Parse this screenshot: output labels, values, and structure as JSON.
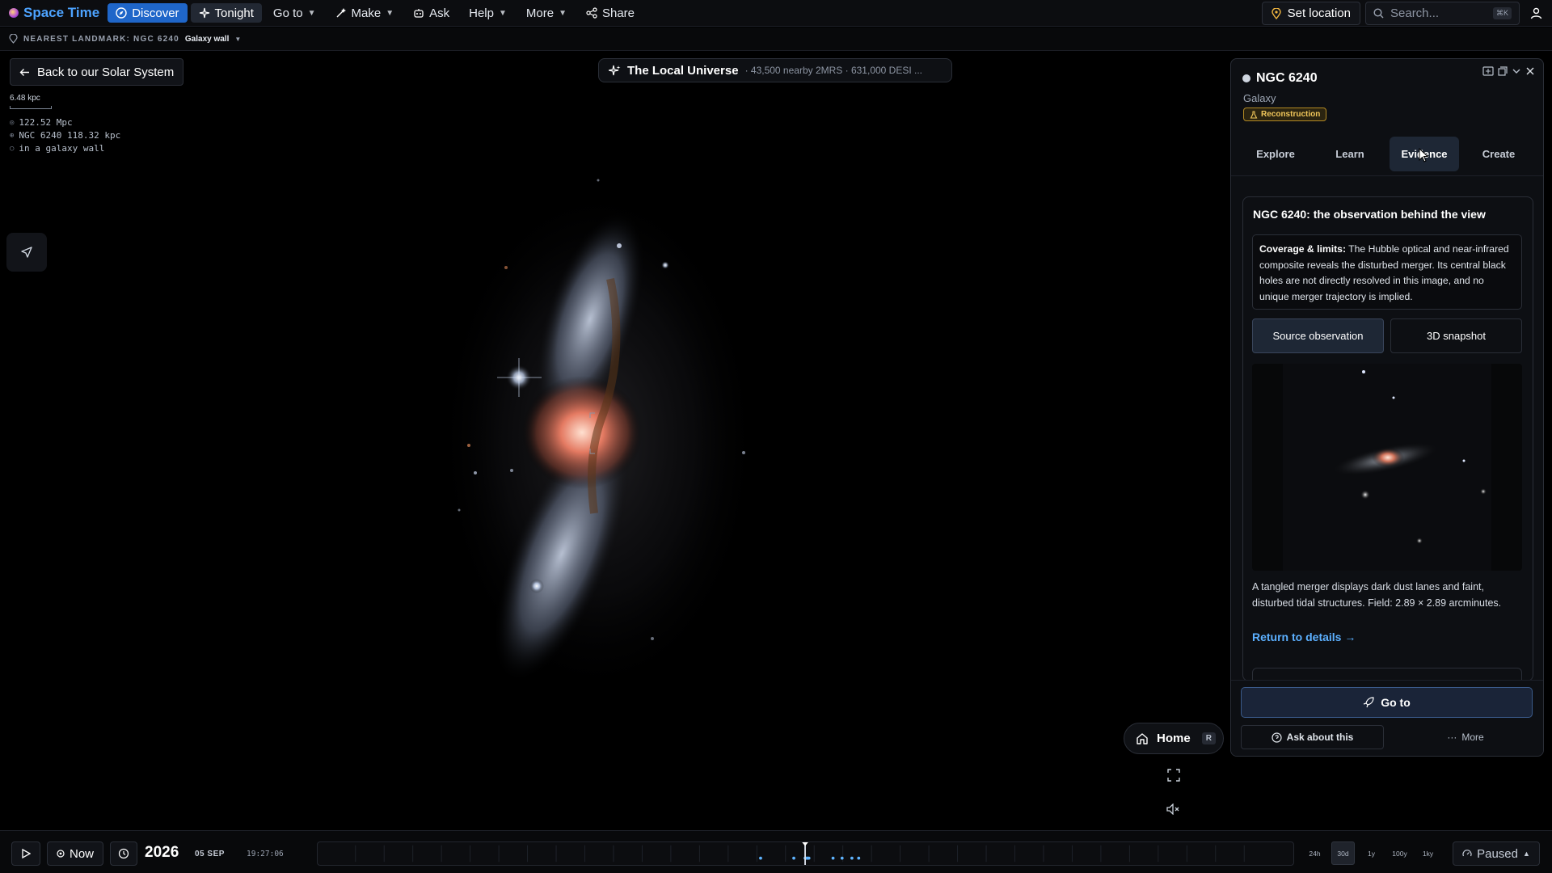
{
  "app": {
    "title": "Space Time"
  },
  "nav": {
    "discover": "Discover",
    "tonight": "Tonight",
    "goto": "Go to",
    "make": "Make",
    "ask": "Ask",
    "help": "Help",
    "more": "More",
    "share": "Share"
  },
  "top_right": {
    "set_location": "Set location",
    "search_placeholder": "Search...",
    "search_shortcut": "⌘K"
  },
  "subbar": {
    "prefix": "NEAREST LANDMARK: NGC 6240",
    "value": "Galaxy wall"
  },
  "back_button": "Back to our Solar System",
  "scale": "6.48 kpc",
  "readouts": [
    {
      "symbol": "◎",
      "text": "122.52 Mpc"
    },
    {
      "symbol": "⊕",
      "text": "NGC 6240 118.32 kpc"
    },
    {
      "symbol": "○",
      "text": "in a galaxy wall"
    }
  ],
  "universe": {
    "title": "The Local Universe",
    "subtitle": "· 43,500 nearby 2MRS · 631,000 DESI ..."
  },
  "home": {
    "label": "Home",
    "shortcut": "R"
  },
  "panel": {
    "title": "NGC 6240",
    "type": "Galaxy",
    "badge": "Reconstruction",
    "tabs": [
      "Explore",
      "Learn",
      "Evidence",
      "Create"
    ],
    "active_tab": "Evidence",
    "card_title": "NGC 6240: the observation behind the view",
    "coverage_label": "Coverage & limits:",
    "coverage_text": " The Hubble optical and near-infrared composite reveals the disturbed merger. Its central black holes are not directly resolved in this image, and no unique merger trajectory is implied.",
    "btn_source": "Source observation",
    "btn_snapshot": "3D snapshot",
    "description": "A tangled merger displays dark dust lanes and faint, disturbed tidal structures. Field: 2.89 × 2.89 arcminutes.",
    "return_link": "Return to details →",
    "goto_label": "Go to",
    "ask_label": "Ask about this",
    "more_label": "More"
  },
  "timeline": {
    "now": "Now",
    "year": "2026",
    "date": "05 SEP",
    "time": "19:27:06",
    "ranges": [
      "24h",
      "30d",
      "1y",
      "100y",
      "1ky"
    ],
    "selected_range": "30d",
    "status": "Paused"
  }
}
